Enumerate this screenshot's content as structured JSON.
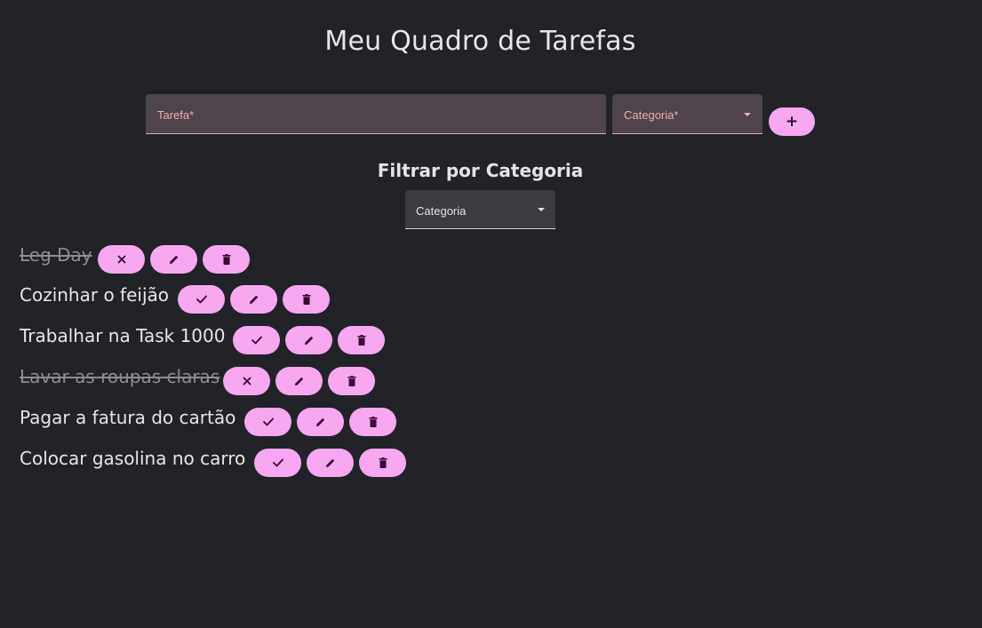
{
  "header": {
    "title": "Meu Quadro de Tarefas"
  },
  "form": {
    "task_label": "Tarefa*",
    "category_label": "Categoria*",
    "add_label": "+"
  },
  "filter": {
    "title": "Filtrar por Categoria",
    "category_label": "Categoria"
  },
  "tasks": [
    {
      "title": "Leg Day",
      "done": true,
      "toggle_icon": "close-icon"
    },
    {
      "title": "Cozinhar o feijão",
      "done": false,
      "toggle_icon": "check-icon"
    },
    {
      "title": "Trabalhar na Task 1000",
      "done": false,
      "toggle_icon": "check-icon"
    },
    {
      "title": "Lavar as roupas claras",
      "done": true,
      "toggle_icon": "close-icon"
    },
    {
      "title": "Pagar a fatura do cartão",
      "done": false,
      "toggle_icon": "check-icon"
    },
    {
      "title": "Colocar gasolina no carro",
      "done": false,
      "toggle_icon": "check-icon"
    }
  ],
  "icons": {
    "edit": "pencil-icon",
    "delete": "trash-icon"
  },
  "colors": {
    "background": "#212328",
    "button": "#f8a7f1",
    "input_fill": "#4d444e",
    "accent": "#f2aeae"
  }
}
